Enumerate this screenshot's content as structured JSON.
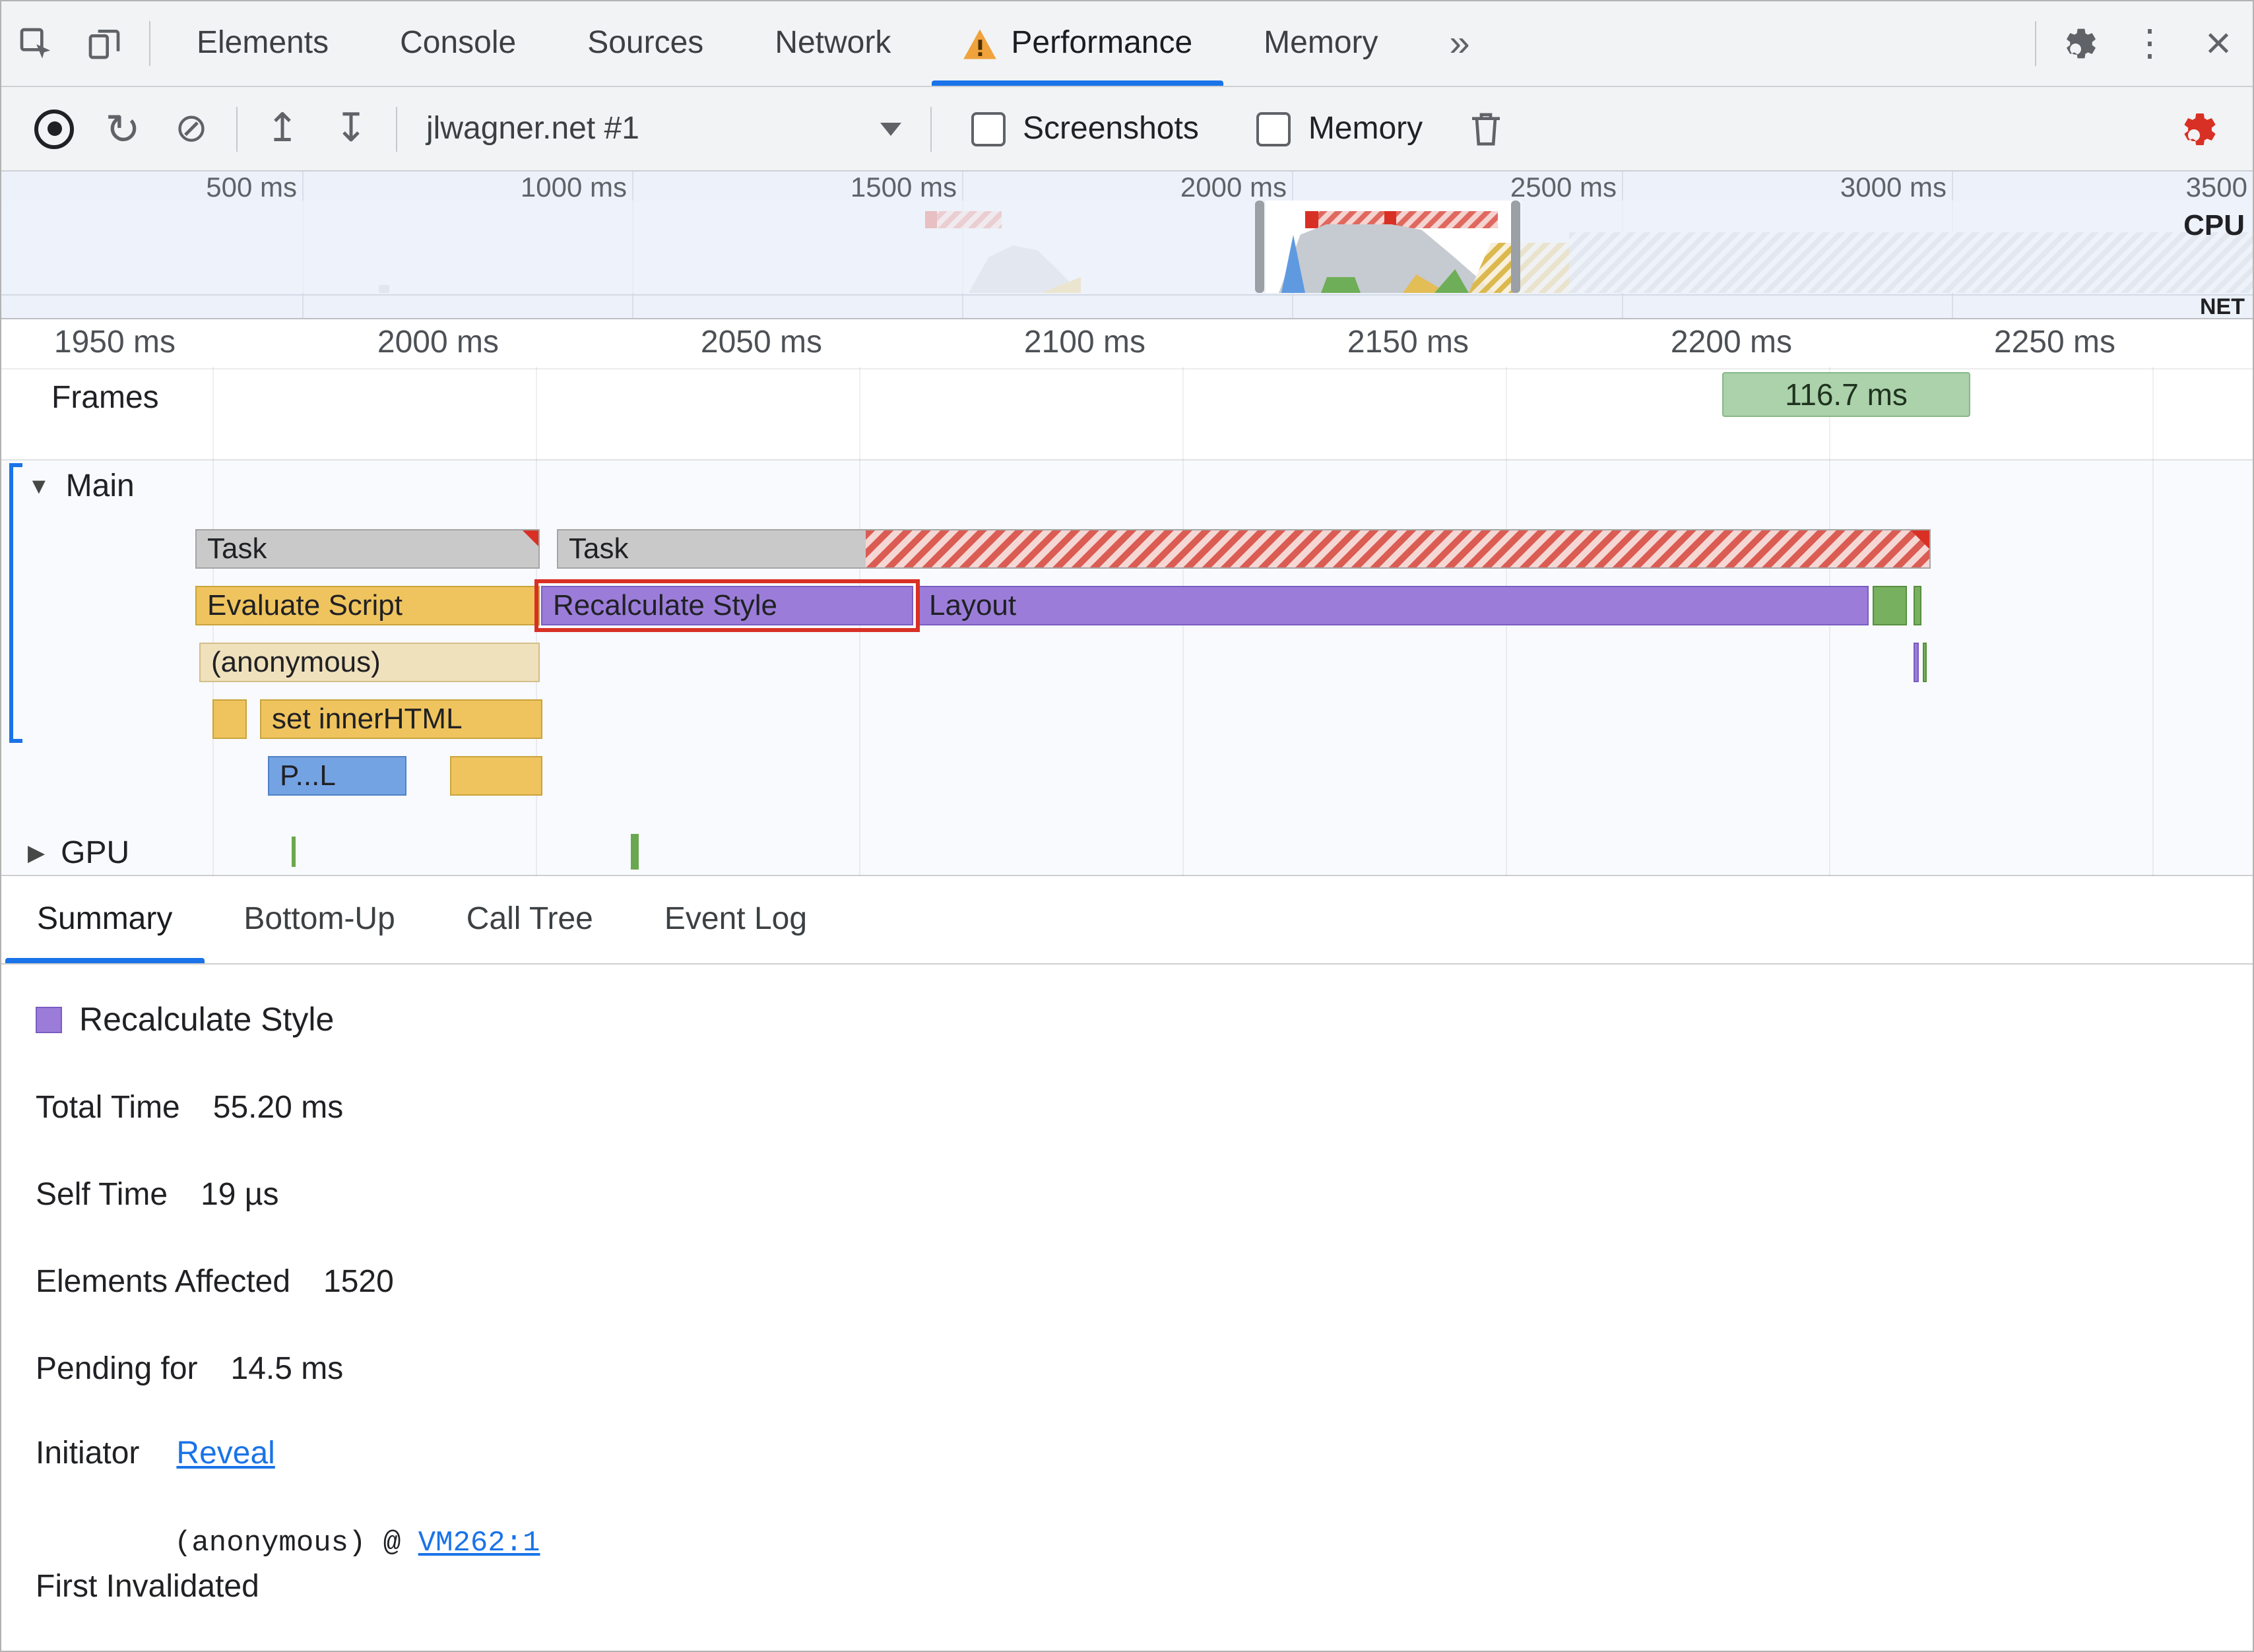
{
  "tabs": {
    "elements": "Elements",
    "console": "Console",
    "sources": "Sources",
    "network": "Network",
    "performance": "Performance",
    "memory": "Memory",
    "more": "»"
  },
  "toolbar": {
    "profile": "jlwagner.net #1",
    "screenshots": "Screenshots",
    "memory": "Memory"
  },
  "overview": {
    "times": [
      "500 ms",
      "1000 ms",
      "1500 ms",
      "2000 ms",
      "2500 ms",
      "3000 ms",
      "3500"
    ],
    "cpu": "CPU",
    "net": "NET"
  },
  "ruler": {
    "times": [
      "1950 ms",
      "2000 ms",
      "2050 ms",
      "2100 ms",
      "2150 ms",
      "2200 ms",
      "2250 ms"
    ]
  },
  "frames": {
    "label": "Frames",
    "value": "116.7 ms"
  },
  "tracks": {
    "main": "Main",
    "gpu": "GPU"
  },
  "flame": {
    "task1": "Task",
    "task2": "Task",
    "evaluate_script": "Evaluate Script",
    "recalculate_style": "Recalculate Style",
    "layout": "Layout",
    "anonymous": "(anonymous)",
    "set_inner_html": "set innerHTML",
    "parse_html": "P...L"
  },
  "bottom_tabs": {
    "summary": "Summary",
    "bottom_up": "Bottom-Up",
    "call_tree": "Call Tree",
    "event_log": "Event Log"
  },
  "summary": {
    "title": "Recalculate Style",
    "rows": [
      {
        "label": "Total Time",
        "value": "55.20 ms"
      },
      {
        "label": "Self Time",
        "value": "19 µs"
      },
      {
        "label": "Elements Affected",
        "value": "1520"
      },
      {
        "label": "Pending for",
        "value": "14.5 ms"
      }
    ],
    "initiator_label": "Initiator",
    "initiator_link": "Reveal",
    "first_invalidated_label": "First Invalidated",
    "stack_text": "(anonymous) @ ",
    "stack_link": "VM262:1"
  }
}
